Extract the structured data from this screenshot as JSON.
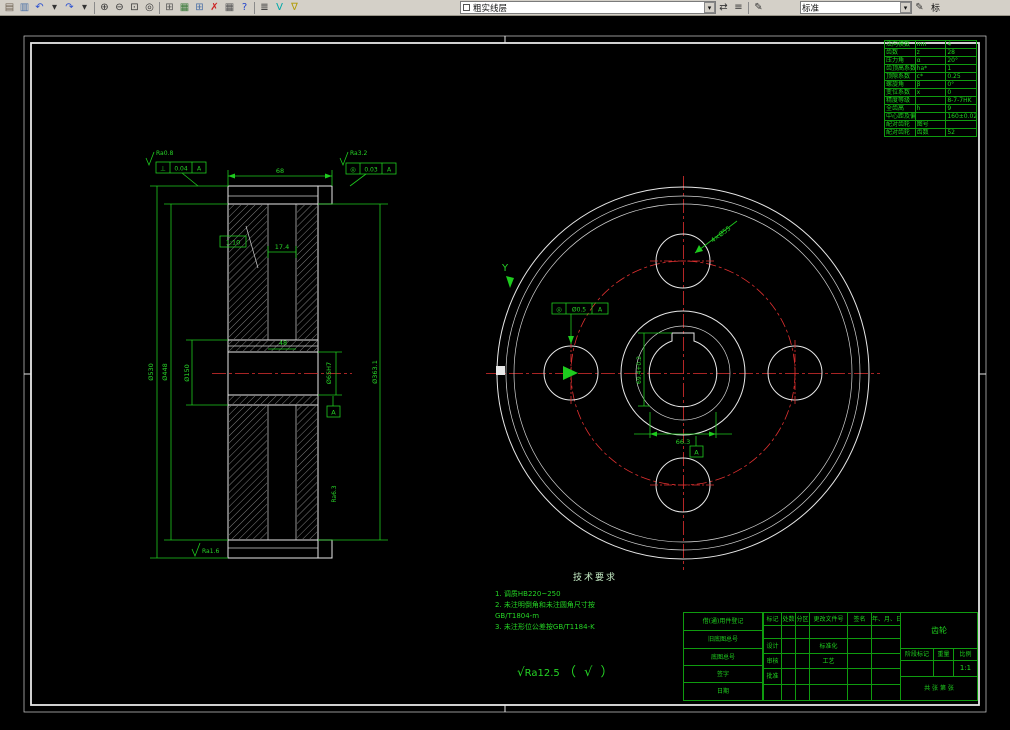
{
  "toolbar": {
    "arrow": "▾",
    "layer_combo": "粗实线层",
    "style_combo": "标准",
    "style_combo2": "标",
    "groups": {
      "g1": [
        {
          "n": "open-icon",
          "g": "▤",
          "c": "#6b5e4e"
        },
        {
          "n": "print-icon",
          "g": "▥",
          "c": "#4a6fa5"
        },
        {
          "n": "undo-icon",
          "g": "↶",
          "c": "#2a4fd0"
        },
        {
          "n": "undo-dropdown-icon",
          "g": "▾",
          "c": "#333333"
        },
        {
          "n": "redo-icon",
          "g": "↷",
          "c": "#2a4fd0"
        },
        {
          "n": "redo-dropdown-icon",
          "g": "▾",
          "c": "#333333"
        },
        {
          "n": "sep"
        },
        {
          "n": "zoom-in-icon",
          "g": "⊕",
          "c": "#333333"
        },
        {
          "n": "zoom-out-icon",
          "g": "⊖",
          "c": "#333333"
        },
        {
          "n": "zoom-window-icon",
          "g": "⊡",
          "c": "#333333"
        },
        {
          "n": "zoom-extents-icon",
          "g": "◎",
          "c": "#333333"
        },
        {
          "n": "sep"
        },
        {
          "n": "table-icon",
          "g": "⊞",
          "c": "#555555"
        },
        {
          "n": "sheet-icon",
          "g": "▦",
          "c": "#3a7a3a"
        },
        {
          "n": "insert-table-icon",
          "g": "⊞",
          "c": "#4a6fa5"
        },
        {
          "n": "delete-table-icon",
          "g": "✗",
          "c": "#cc2222"
        },
        {
          "n": "cells-icon",
          "g": "▦",
          "c": "#555555"
        },
        {
          "n": "help-icon",
          "g": "?",
          "c": "#2244cc"
        },
        {
          "n": "sep"
        },
        {
          "n": "layers-icon",
          "g": "≣",
          "c": "#333333"
        },
        {
          "n": "layer-visibility-icon",
          "g": "V",
          "c": "#00a8a8"
        },
        {
          "n": "layer-filter-icon",
          "g": "∇",
          "c": "#b09a00"
        }
      ],
      "g2": [
        {
          "n": "layer-previous-icon",
          "g": "⇄",
          "c": "#333333"
        },
        {
          "n": "layer-state-icon",
          "g": "≡",
          "c": "#333333"
        },
        {
          "n": "sep"
        },
        {
          "n": "edit-linetype-icon",
          "g": "✎",
          "c": "#333333"
        }
      ],
      "g3": [
        {
          "n": "edit-style-icon",
          "g": "✎",
          "c": "#333333"
        }
      ]
    }
  },
  "param_table": {
    "rows": [
      [
        "法向模数",
        "mn",
        "4"
      ],
      [
        "齿数",
        "z",
        "28"
      ],
      [
        "压力角",
        "α",
        "20°"
      ],
      [
        "齿顶高系数",
        "ha*",
        "1"
      ],
      [
        "顶隙系数",
        "c*",
        "0.25"
      ],
      [
        "螺旋角",
        "β",
        "0°"
      ],
      [
        "变位系数",
        "x",
        "0"
      ],
      [
        "精度等级",
        "",
        "8-7-7HK"
      ],
      [
        "全齿高",
        "h",
        "9"
      ],
      [
        "中心距及偏差",
        "",
        "160±0.027"
      ],
      [
        "配对齿轮",
        "图号",
        ""
      ],
      [
        "配对齿轮",
        "齿数",
        "52"
      ]
    ]
  },
  "left_view": {
    "dim_top": "68",
    "dim_17": "17.4",
    "dim_48": "48",
    "taper": "1:10",
    "d_outer": "Ø530",
    "d_mid": "Ø448",
    "d_hub": "Ø150",
    "d_right": "Ø363.1",
    "bore": "Ø65H7",
    "gdt_left_sym": "⊥",
    "gdt_left_val": "0.04",
    "gdt_left_ref": "A",
    "gdt_right_sym": "◎",
    "gdt_right_val": "0.03",
    "gdt_right_ref": "A",
    "ra_left": "Ra0.8",
    "ra_right": "Ra3.2",
    "ra_bottom": "Ra1.6",
    "ra_side": "Ra6.3",
    "datum": "A"
  },
  "right_view": {
    "holes": "4×Ø55",
    "gdt_sym": "◎",
    "gdt_val": "Ø0.5",
    "gdt_ref": "A",
    "axis_label": "Y",
    "dim_h": "66.3",
    "dim_v": "69.4+0.2",
    "datum": "A"
  },
  "tech_req": {
    "title": "技术要求",
    "items": [
      "1. 调质HB220~250",
      "2. 未注明倒角和未注圆角尺寸按",
      "GB/T1804-m",
      "3. 未注形位公差按GB/T1184-K"
    ]
  },
  "surface_note": {
    "sym": "√",
    "value": "Ra12.5",
    "paren": "（ √ ）"
  },
  "title_block": {
    "left_rows": [
      "借(通)用件登记",
      "旧底图总号",
      "底图总号",
      "签字",
      "日期"
    ],
    "main_grid": [
      [
        "标记",
        "处数",
        "分区",
        "更改文件号",
        "签名",
        "年、月、日"
      ],
      [
        "",
        "",
        "",
        "",
        "",
        ""
      ],
      [
        "设计",
        "",
        "",
        "标准化",
        "",
        ""
      ],
      [
        "审核",
        "",
        "",
        "工艺",
        "",
        ""
      ],
      [
        "批准",
        "",
        "",
        "",
        "",
        ""
      ],
      [
        "",
        "",
        "",
        "",
        "",
        ""
      ]
    ],
    "right": {
      "name": "齿轮",
      "stage": "阶段标记",
      "weight": "重量",
      "scale_label": "比例",
      "scale": "1:1",
      "sheets": "共 张  第 张"
    }
  }
}
